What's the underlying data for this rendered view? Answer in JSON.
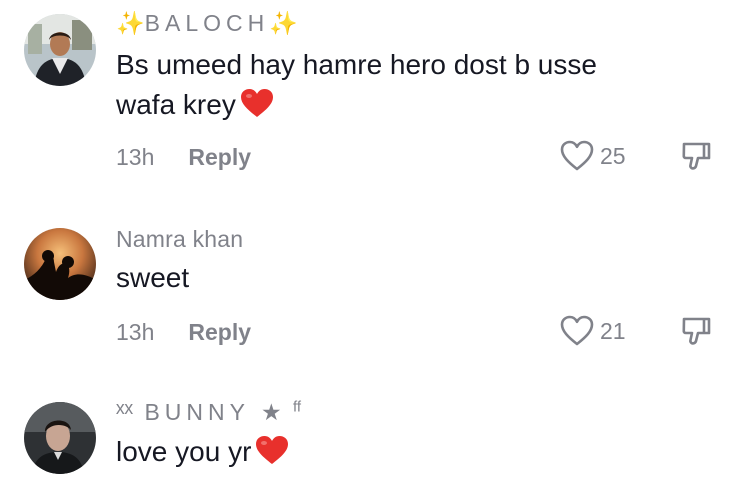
{
  "comments": [
    {
      "username_sparkle_left": "✨",
      "username": "BALOCH",
      "username_sparkle_right": "✨",
      "text_line1": "Bs umeed hay hamre hero dost b usse",
      "text_line2": "wafa krey",
      "emoji": "❤️",
      "time": "13h",
      "reply_label": "Reply",
      "likes": "25",
      "avatar_icon": "person-avatar-icon"
    },
    {
      "username": "Namra khan",
      "text": "sweet",
      "time": "13h",
      "reply_label": "Reply",
      "likes": "21",
      "avatar_icon": "sunset-couple-avatar-icon"
    },
    {
      "username_prefix": "ˣˣ",
      "username": "BUNNY",
      "username_suffix": "★",
      "username_sup": "ff",
      "text": "love you yr",
      "emoji": "❤️",
      "avatar_icon": "man-portrait-avatar-icon"
    }
  ],
  "icons": {
    "like": "heart-outline-icon",
    "dislike": "thumbs-down-icon",
    "heart_emoji": "red-heart-emoji"
  },
  "colors": {
    "text": "#161823",
    "secondary": "#80828a",
    "sparkle": "#f2cf45",
    "heart": "#e8302c"
  }
}
